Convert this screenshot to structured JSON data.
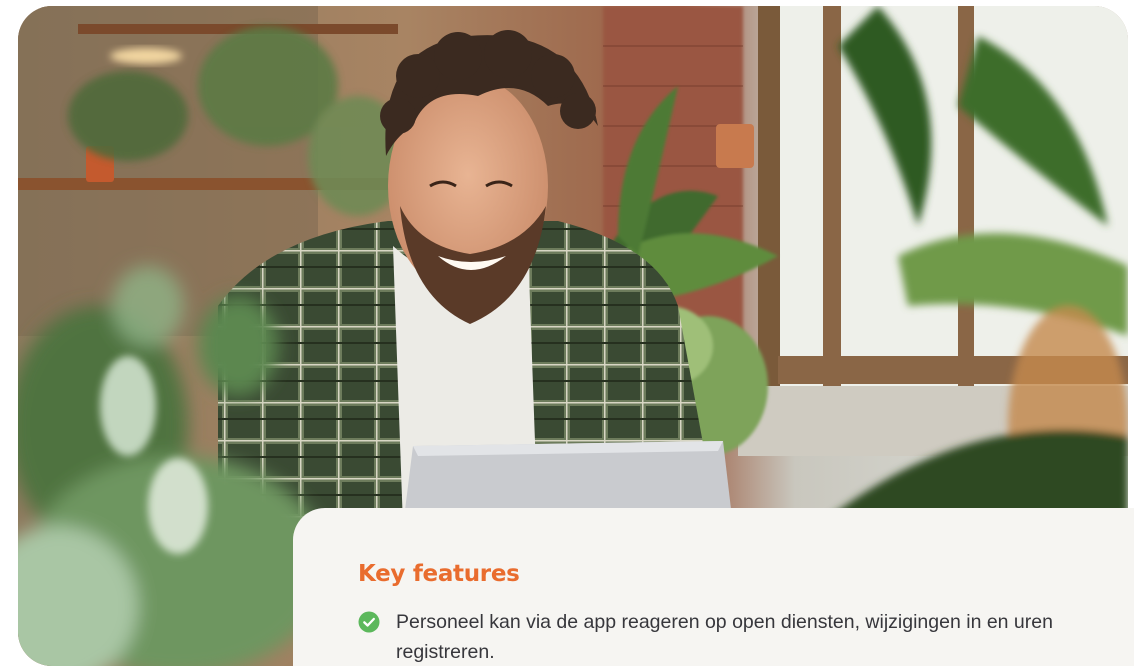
{
  "hero": {
    "image_alt_icon": "photo-icon"
  },
  "features": {
    "title": "Key features",
    "title_color": "#e96c2e",
    "items": [
      {
        "icon": "check-circle-icon",
        "icon_color": "#5cb85c",
        "text": "Personeel kan via de app reageren op open diensten, wijzigingen in en uren registreren."
      }
    ]
  }
}
